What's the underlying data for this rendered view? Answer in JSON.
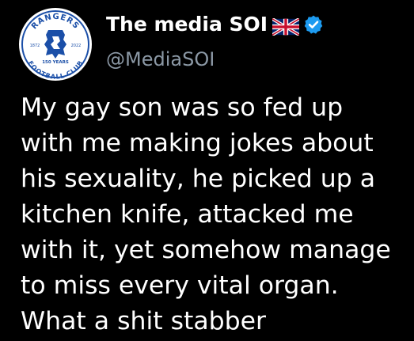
{
  "author": {
    "display_name": "The media SOI",
    "handle": "@MediaSOI",
    "flag_icon": "uk-flag-icon",
    "verified_icon": "verified-badge-icon",
    "verified_color": "#1d9bf0",
    "avatar_icon": "rangers-crest-icon",
    "avatar_text_top": "RANGERS",
    "avatar_text_bottom": "FOOTBALL CLUB",
    "avatar_year_left": "1872",
    "avatar_year_right": "2022",
    "avatar_anniversary": "150 YEARS"
  },
  "tweet": {
    "lines": [
      "My gay son was so fed up",
      "with me making jokes about",
      "his sexuality, he picked up a",
      "kitchen knife, attacked me",
      "with it, yet somehow manage",
      "to miss every vital organ.",
      "What a shit stabber"
    ]
  },
  "colors": {
    "background": "#000000",
    "text": "#ffffff",
    "secondary_text": "#8b98a5",
    "crest_blue": "#1b4fa8"
  }
}
